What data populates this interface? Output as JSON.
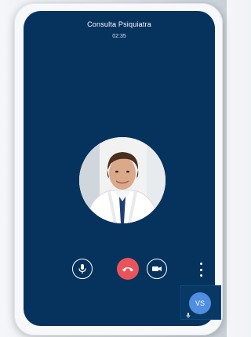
{
  "call": {
    "title": "Consulta Psiquiatra",
    "duration": "02:35"
  },
  "self_view": {
    "initials": "VS"
  },
  "colors": {
    "screen_background": "#06335e",
    "end_call": "#e9545a",
    "self_avatar": "#4f8ee0"
  },
  "icons": {
    "mic": "microphone-icon",
    "end": "phone-hangup-icon",
    "camera": "video-camera-icon",
    "more": "more-vertical-icon"
  }
}
